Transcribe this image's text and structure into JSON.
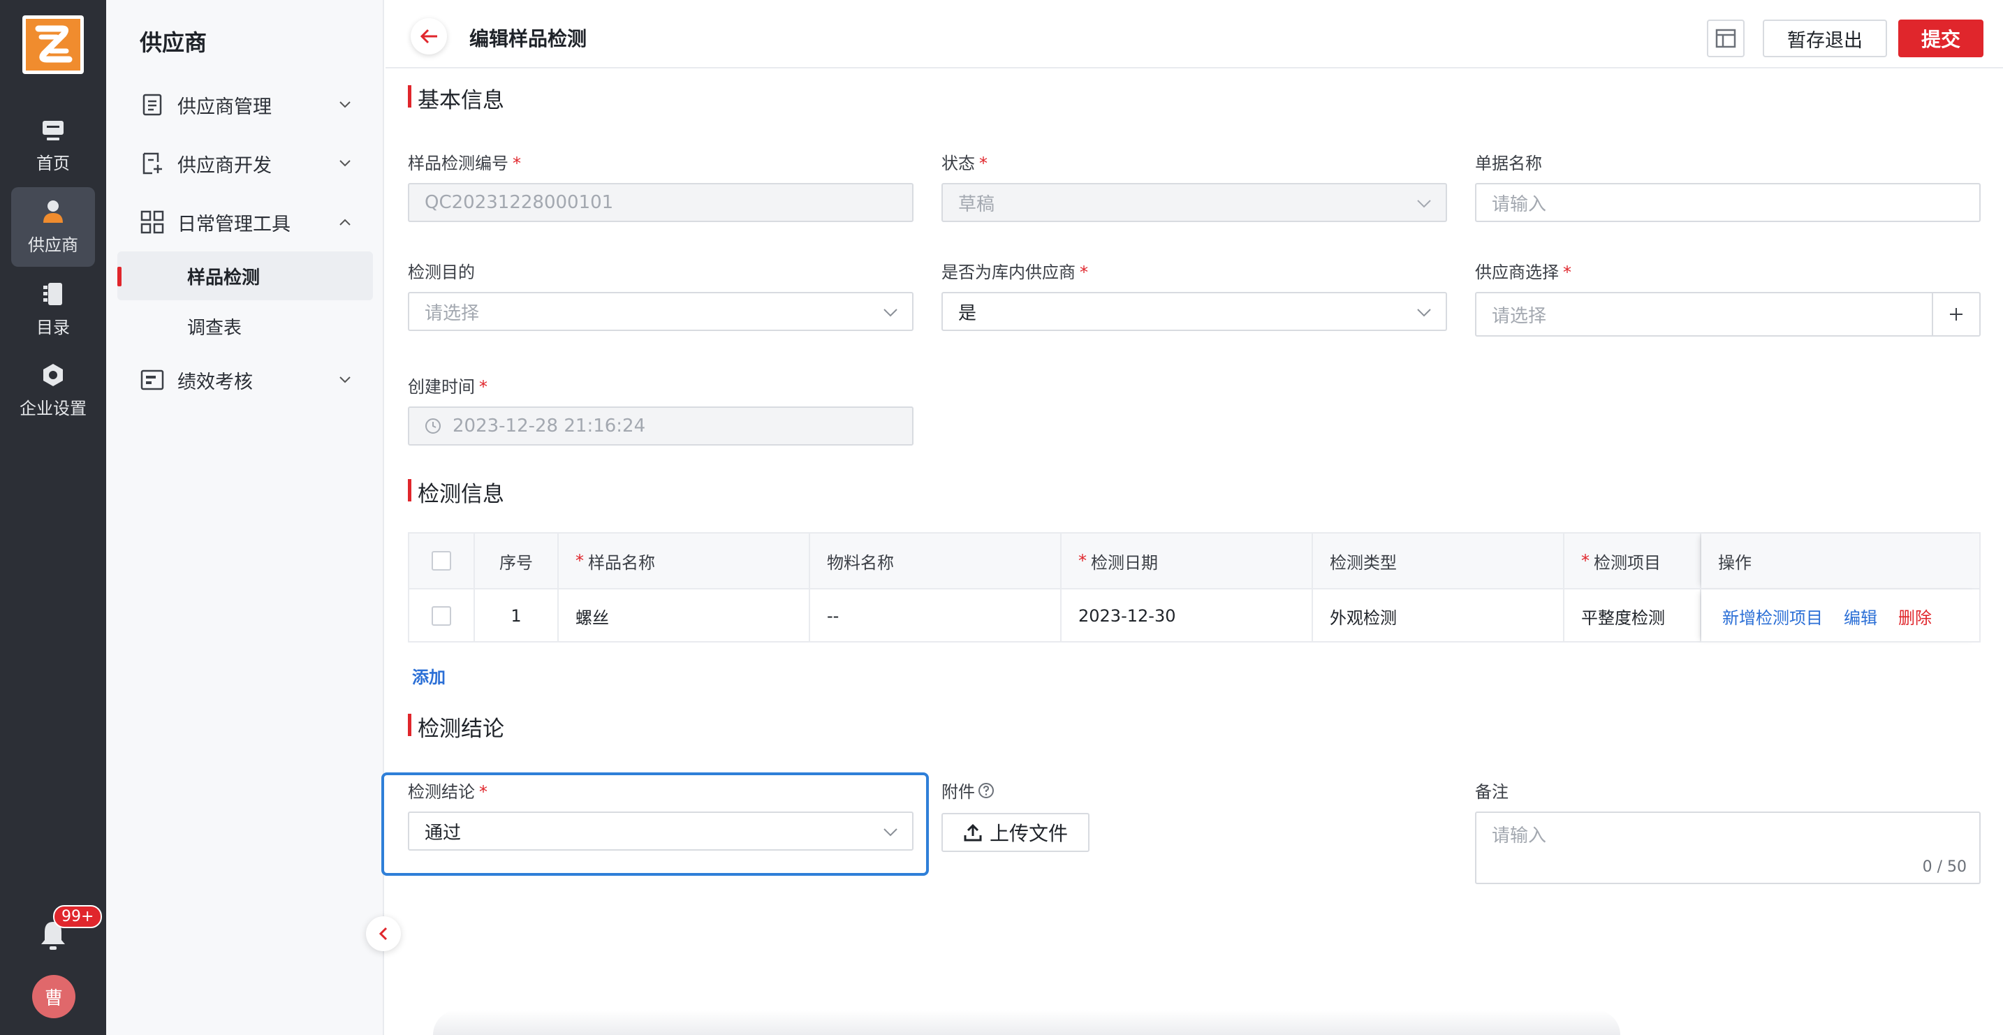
{
  "rail": {
    "items": [
      {
        "label": "首页",
        "icon": "home-monitor-icon"
      },
      {
        "label": "供应商",
        "icon": "person-icon",
        "active": true
      },
      {
        "label": "目录",
        "icon": "catalog-icon"
      },
      {
        "label": "企业设置",
        "icon": "hexagon-settings-icon"
      }
    ],
    "notification_badge": "99+",
    "avatar_text": "曹"
  },
  "subside": {
    "title": "供应商",
    "groups": [
      {
        "label": "供应商管理"
      },
      {
        "label": "供应商开发"
      },
      {
        "label": "日常管理工具"
      },
      {
        "label": "绩效考核"
      }
    ],
    "subitems": [
      {
        "label": "样品检测",
        "active": true
      },
      {
        "label": "调查表"
      }
    ]
  },
  "header": {
    "title": "编辑样品检测",
    "save_exit": "暂存退出",
    "submit": "提交"
  },
  "basic": {
    "section": "基本信息",
    "code_label": "样品检测编号",
    "code_value": "QC20231228000101",
    "status_label": "状态",
    "status_value": "草稿",
    "name_label": "单据名称",
    "name_placeholder": "请输入",
    "purpose_label": "检测目的",
    "purpose_placeholder": "请选择",
    "in_stock_label": "是否为库内供应商",
    "in_stock_value": "是",
    "supplier_label": "供应商选择",
    "supplier_placeholder": "请选择",
    "created_label": "创建时间",
    "created_value": "2023-12-28 21:16:24"
  },
  "inspection": {
    "section": "检测信息",
    "columns": [
      "序号",
      "样品名称",
      "物料名称",
      "检测日期",
      "检测类型",
      "检测项目",
      "操作"
    ],
    "rows": [
      {
        "index": "1",
        "sample": "螺丝",
        "material": "--",
        "date": "2023-12-30",
        "type": "外观检测",
        "item": "平整度检测"
      }
    ],
    "actions": {
      "add_item": "新增检测项目",
      "edit": "编辑",
      "delete": "删除"
    },
    "add_link": "添加"
  },
  "conclusion": {
    "section": "检测结论",
    "result_label": "检测结论",
    "result_value": "通过",
    "attachment_label": "附件",
    "upload_label": "上传文件",
    "remark_label": "备注",
    "remark_placeholder": "请输入",
    "remark_counter": "0 / 50"
  },
  "colors": {
    "accent": "#e0262c",
    "link": "#2b6fd6",
    "focus": "#2f7fd8",
    "rail": "#2c2f36"
  }
}
